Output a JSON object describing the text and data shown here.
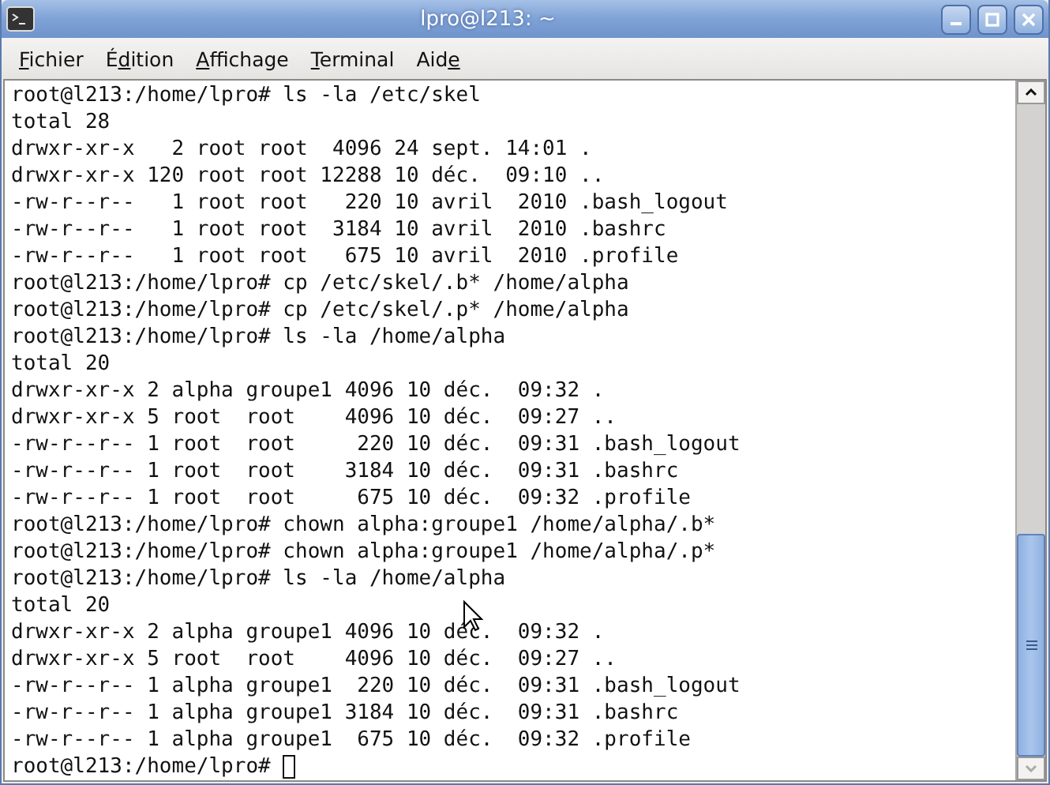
{
  "window": {
    "title": "lpro@l213: ~"
  },
  "menu": [
    {
      "mnemonic": "F",
      "after": "ichier"
    },
    {
      "before": "É",
      "mnemonic": "d",
      "after": "ition"
    },
    {
      "mnemonic": "A",
      "after": "ffichage"
    },
    {
      "mnemonic": "T",
      "after": "erminal"
    },
    {
      "before": "Aid",
      "mnemonic": "e"
    }
  ],
  "terminal": {
    "lines": [
      "root@l213:/home/lpro# ls -la /etc/skel",
      "total 28",
      "drwxr-xr-x   2 root root  4096 24 sept. 14:01 .",
      "drwxr-xr-x 120 root root 12288 10 déc.  09:10 ..",
      "-rw-r--r--   1 root root   220 10 avril  2010 .bash_logout",
      "-rw-r--r--   1 root root  3184 10 avril  2010 .bashrc",
      "-rw-r--r--   1 root root   675 10 avril  2010 .profile",
      "root@l213:/home/lpro# cp /etc/skel/.b* /home/alpha",
      "root@l213:/home/lpro# cp /etc/skel/.p* /home/alpha",
      "root@l213:/home/lpro# ls -la /home/alpha",
      "total 20",
      "drwxr-xr-x 2 alpha groupe1 4096 10 déc.  09:32 .",
      "drwxr-xr-x 5 root  root    4096 10 déc.  09:27 ..",
      "-rw-r--r-- 1 root  root     220 10 déc.  09:31 .bash_logout",
      "-rw-r--r-- 1 root  root    3184 10 déc.  09:31 .bashrc",
      "-rw-r--r-- 1 root  root     675 10 déc.  09:32 .profile",
      "root@l213:/home/lpro# chown alpha:groupe1 /home/alpha/.b*",
      "root@l213:/home/lpro# chown alpha:groupe1 /home/alpha/.p*",
      "root@l213:/home/lpro# ls -la /home/alpha",
      "total 20",
      "drwxr-xr-x 2 alpha groupe1 4096 10 déc.  09:32 .",
      "drwxr-xr-x 5 root  root    4096 10 déc.  09:27 ..",
      "-rw-r--r-- 1 alpha groupe1  220 10 déc.  09:31 .bash_logout",
      "-rw-r--r-- 1 alpha groupe1 3184 10 déc.  09:31 .bashrc",
      "-rw-r--r-- 1 alpha groupe1  675 10 déc.  09:32 .profile"
    ],
    "prompt": "root@l213:/home/lpro# "
  }
}
